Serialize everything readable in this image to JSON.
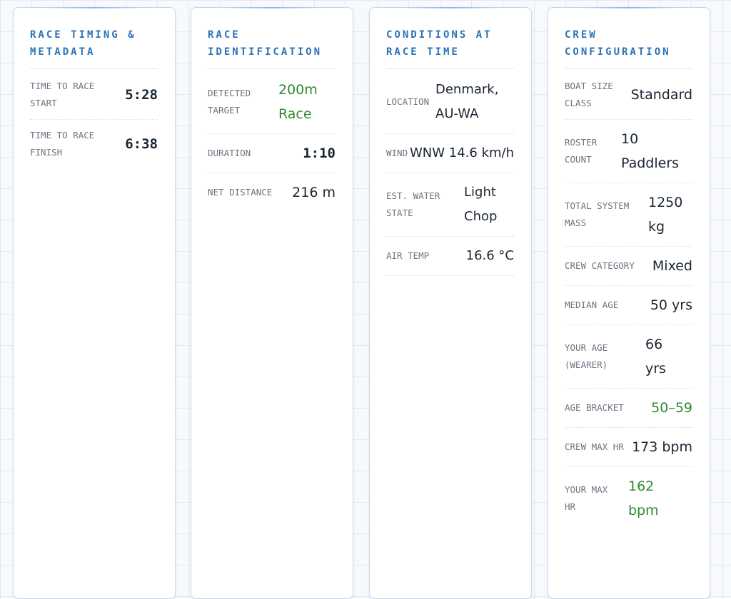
{
  "panels": {
    "timing": {
      "title": "Race Timing & Metadata",
      "rows": [
        {
          "label": "Time to Race Start",
          "value": "5:28"
        },
        {
          "label": "Time to Race Finish",
          "value": "6:38"
        }
      ]
    },
    "identification": {
      "title": "Race Identification",
      "rows": [
        {
          "label": "Detected Target",
          "value": "200m Race"
        },
        {
          "label": "Duration",
          "value": "1:10"
        },
        {
          "label": "Net Distance",
          "value": "216 m"
        }
      ]
    },
    "conditions": {
      "title": "Conditions at Race Time",
      "rows": [
        {
          "label": "Location",
          "value": "Denmark, AU-WA"
        },
        {
          "label": "Wind",
          "value": "WNW 14.6 km/h"
        },
        {
          "label": "Est. Water State",
          "value": "Light Chop"
        },
        {
          "label": "Air Temp",
          "value": "16.6 °C"
        }
      ]
    },
    "crew": {
      "title": "Crew Configuration",
      "rows": [
        {
          "label": "Boat Size Class",
          "value": "Standard"
        },
        {
          "label": "Roster Count",
          "value": "10 Paddlers"
        },
        {
          "label": "Total System Mass",
          "value": "1250 kg"
        },
        {
          "label": "Crew Category",
          "value": "Mixed"
        },
        {
          "label": "Median Age",
          "value": "50 yrs"
        },
        {
          "label": "Your Age (Wearer)",
          "value": "66 yrs"
        },
        {
          "label": "Age Bracket",
          "value": "50–59"
        },
        {
          "label": "Crew Max HR",
          "value": "173 bpm"
        },
        {
          "label": "Your Max HR",
          "value": "162 bpm"
        }
      ]
    }
  },
  "colors": {
    "title": "#2a73b8",
    "highlight": "#2e8b2e",
    "value": "#1a2533",
    "label": "#6b7480"
  }
}
